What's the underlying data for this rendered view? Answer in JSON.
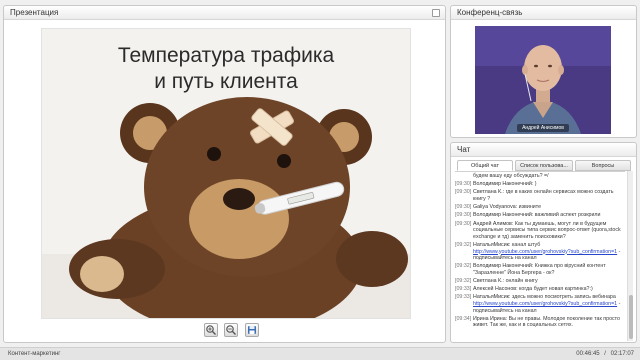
{
  "presentation": {
    "title": "Презентация",
    "slide_title_line1": "Температура трафика",
    "slide_title_line2": "и путь клиента"
  },
  "conference": {
    "title": "Конференц-связь",
    "speaker_name": "Андрей Анисимов"
  },
  "chat": {
    "title": "Чат",
    "tabs": [
      "Общий чат",
      "Список пользова...",
      "Вопросы"
    ],
    "messages": [
      {
        "time": "",
        "author": "",
        "text": "будем вашу еду обсуждать? =/",
        "highlight": true
      },
      {
        "time": "[09:30]",
        "author": "Володимир Наконечний:",
        "text": ")",
        "highlight": false
      },
      {
        "time": "[09:30]",
        "author": "Светлана К.:",
        "text": "где в каких онлайн сервисах можно создать книгу ?",
        "highlight": false
      },
      {
        "time": "[09:30]",
        "author": "Galiya Vodyanova:",
        "text": "извините",
        "highlight": false
      },
      {
        "time": "[09:30]",
        "author": "Володимир Наконечний:",
        "text": "важливий аспект розкрили",
        "highlight": false
      },
      {
        "time": "[09:30]",
        "author": "Андрей Алимов:",
        "text": "Как ты думаешь, могут ли в будущем социальные сервисы типа сервис вопрос-ответ (quora,stock exchange и тд) заменить поисковики?",
        "highlight": false
      },
      {
        "time": "[09:32]",
        "author": "НатальяМисик:",
        "text": "канал штуб",
        "link": "http://www.youtube.com/user/grohovskiy?sub_confirmation=1",
        "after": " - подписывайтесь на канал",
        "highlight": true
      },
      {
        "time": "[09:32]",
        "author": "Володимир Наконечний:",
        "text": "Книжка про вірусний контент \"Заразленне\" Йона Бергера - ок?",
        "highlight": false
      },
      {
        "time": "[09:32]",
        "author": "Светлана К.:",
        "text": "онлайн книгу",
        "highlight": false
      },
      {
        "time": "[09:33]",
        "author": "Алексей Насонов:",
        "text": "когда будет новая картинка?:)",
        "highlight": false
      },
      {
        "time": "[09:33]",
        "author": "НатальяМисик:",
        "text": "здесь можно посмотреть запись вебинара",
        "link": "http://www.youtube.com/user/grohovskiy?sub_confirmation=1",
        "after": " - подписывайтесь на канал",
        "highlight": true
      },
      {
        "time": "[09:34]",
        "author": "Ирина Ирина:",
        "text": "Вы не правы. Молодое поколение так просто живет. Так же, как и в социальных сетях.",
        "highlight": false
      }
    ]
  },
  "status": {
    "left": "Контент-маркетинг",
    "time_elapsed": "00:46:45",
    "time_total": "02:17:07"
  }
}
